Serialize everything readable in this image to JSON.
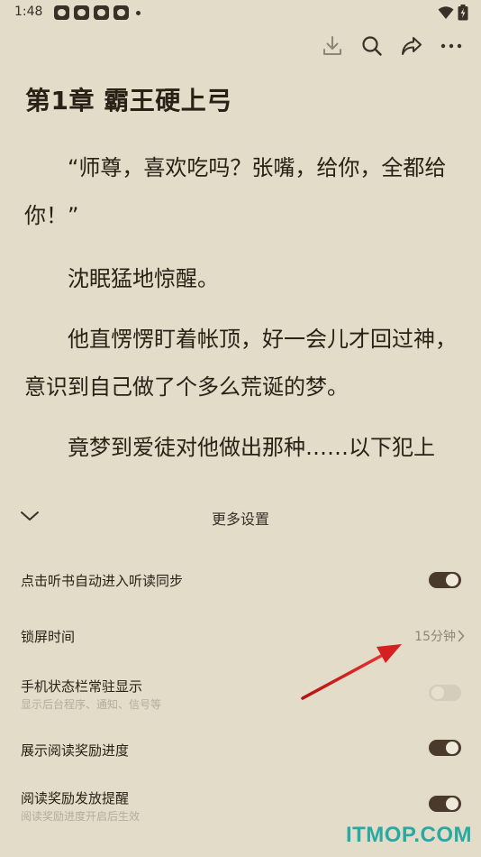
{
  "status_bar": {
    "time": "1:48"
  },
  "toolbar": {
    "icons": [
      "download-icon",
      "search-icon",
      "share-icon",
      "more-icon"
    ]
  },
  "chapter": {
    "title": "第1章 霸王硬上弓",
    "paragraphs": [
      "“师尊，喜欢吃吗？张嘴，给你，全都给你！”",
      "沈眠猛地惊醒。",
      "他直愣愣盯着帐顶，好一会儿才回过神，意识到自己做了个多么荒诞的梦。",
      "竟梦到爱徒对他做出那种……以下犯上"
    ]
  },
  "settings_panel": {
    "title": "更多设置",
    "rows": [
      {
        "label": "点击听书自动进入听读同步",
        "toggle": "on"
      },
      {
        "label": "锁屏时间",
        "value": "15分钟"
      },
      {
        "label": "手机状态栏常驻显示",
        "sub": "显示后台程序、通知、信号等",
        "toggle": "off"
      },
      {
        "label": "展示阅读奖励进度",
        "toggle": "on"
      },
      {
        "label": "阅读奖励发放提醒",
        "sub": "阅读奖励进度开启后生效",
        "toggle": "on"
      }
    ]
  },
  "watermark": "ITMOP.COM",
  "colors": {
    "background": "#e2dcc9",
    "text": "#2b2016",
    "toggle_on": "#4a3a2c",
    "toggle_off": "#d4cdbb",
    "annotation_arrow": "#d42020",
    "watermark": "#2aa9a3"
  }
}
